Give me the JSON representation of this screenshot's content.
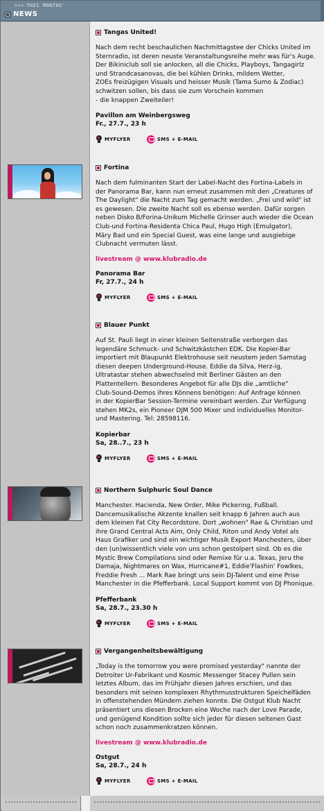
{
  "header": {
    "subtitle": "THIS MONTHS'",
    "arrows": ">>>",
    "title": "NEWS"
  },
  "actions": {
    "flyer_label": "MYFLYER",
    "sms_label": "SMS + E-MAIL"
  },
  "articles": [
    {
      "title": "Tangas United!",
      "body": "Nach dem recht beschaulichen Nachmittagstee der Chicks United im\nSternradio, ist deren neuste Veranstaltungsreihe mehr was für's Auge.\nDer Bikiniclub soll sie anlocken, all die Chicks, Playboys, Tangagirlz\nund Strandcasanovas, die bei kühlen Drinks, mildem Wetter,\nZOEs freizügigen Visuals und heisser Musik (Tama Sumo & Zodiac)\nschwitzen sollen, bis dass sie zum Vorschein kommen\n- die knappen Zweiteiler!",
      "link": "",
      "venue": "Pavillon am Weinbergsweg",
      "date": "Fr., 27.7., 23 h"
    },
    {
      "title": "Fortina",
      "body": "Nach dem fulminanten Start der Label-Nacht des Fortina-Labels in\nder Panorama Bar, kann nun erneut zusammen mit den „Creatures of\nThe Daylight\" die Nacht zum Tag gemacht werden. „Frei und wild\" ist\nes gewesen. Die zweite Nacht soll es ebenso werden. Dafür sorgen\nneben Disko B/Forina-Unikum Michelle Grinser auch wieder die Ocean\nClub-und Fortina-Residenta Chica Paul, Hugo High (Emulgator),\nMäry Bad und ein Special Guest, was eine lange und ausgiebige\nClubnacht vermuten lässt.",
      "link": "livestream @ www.klubradio.de",
      "venue": "Panorama Bar",
      "date": "Fr, 27.7., 24 h"
    },
    {
      "title": "Blauer Punkt",
      "body": "Auf St. Pauli liegt in einer kleinen Seitenstraße verborgen das\nlegendäre Schmuck- und Schwitzkästchen EDK. Die Kopier-Bar\nimportiert mit Blaupunkt Elektrohouse seit neustem jeden Samstag\ndiesen deepen Underground-House. Eddie da Silva, Herz-ig,\nUltratastar stehen abwechselnd mit Berliner Gästen an den\nPlattentellern. Besonderes Angebot für alle DJs die „amtliche\"\nClub-Sound-Demos ihres Könnens benötigen: Auf Anfrage können\nin der KopierBar Session-Termine vereinbart werden. Zur Verfügung\nstehen MK2s, ein Pioneer DJM 500 Mixer und individuelles Monitor-\nund Mastering. Tel: 28598116.",
      "link": "",
      "venue": "Kopierbar",
      "date": "Sa, 28..7., 23 h"
    },
    {
      "title": "Northern Sulphuric Soul Dance",
      "body": "Manchester. Hacienda, New Order, Mike Pickering, Fußball.\nDancemusikalische Akzente knallen seit knapp 6 Jahren auch aus\ndem kleinen Fat City Recordstore. Dort „wohnen\" Rae & Christian und\nihre Grand Central Acts Aim, Only Child, Riton und Andy Votel als\nHaus Grafiker und sind ein wichtiger Musik Export Manchesters, über\nden (un)wissentlich viele von uns schon gestolpert sind. Ob es die\nMystic Brew Compilations sind oder Remixe für u.a. Texas, Jeru the\nDamaja, Nightmares on Wax, Hurricane#1, Eddie'Flashin' Fowlkes,\nFreddie Fresh ... Mark Rae bringt uns sein DJ-Talent und eine Prise\nManchester in die Pfefferbank. Local Support kommt von DJ Phonique.",
      "link": "",
      "venue": "Pfefferbank",
      "date": "Sa, 28.7., 23.30 h"
    },
    {
      "title": "Vergangenheitsbewältigung",
      "body": "„Today is the tomorrow you were promised yesterday\" nannte der\nDetroiter Ur-Fabrikant und Kosmic Messenger Stacey Pullen sein\nletztes Album, das im Frühjahr diesen Jahres erschien, und das\nbesonders mit seinen komplexen Rhythmusstrukturen Speichelfäden\nin offenstehenden Mündern ziehen konnte. Die Ostgut Klub Nacht\npräsentiert uns diesen Brocken eine Woche nach der Love Parade,\nund genügend Kondition sollte sich jeder für diesen seltenen Gast\nschon noch zusammenkratzen können.",
      "link": "livestream @ www.klubradio.de",
      "venue": "Ostgut",
      "date": "Sa, 28.7., 24 h"
    }
  ]
}
